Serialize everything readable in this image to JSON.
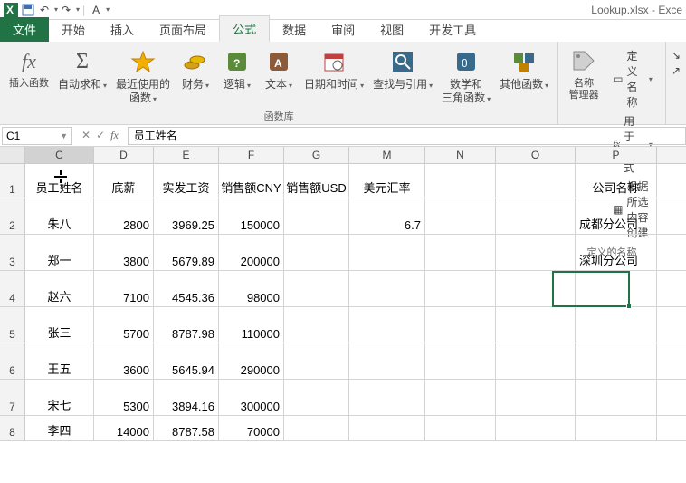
{
  "app": {
    "title": "Lookup.xlsx - Exce"
  },
  "qat": {
    "undo": "↶",
    "redo": "↷",
    "letter": "A"
  },
  "tabs": {
    "file": "文件",
    "home": "开始",
    "insert": "插入",
    "layout": "页面布局",
    "formula": "公式",
    "data": "数据",
    "review": "审阅",
    "view": "视图",
    "dev": "开发工具"
  },
  "ribbon": {
    "insert_fn": "插入函数",
    "autosum": "自动求和",
    "recent": "最近使用的\n函数",
    "finance": "财务",
    "logic": "逻辑",
    "text": "文本",
    "datetime": "日期和时间",
    "lookup": "查找与引用",
    "math": "数学和\n三角函数",
    "other": "其他函数",
    "group_lib": "函数库",
    "name_mgr": "名称\n管理器",
    "def_name": "定义名称",
    "use_in": "用于公式",
    "from_sel": "根据所选内容创建",
    "group_names": "定义的名称"
  },
  "namebox": "C1",
  "formula_value": "员工姓名",
  "columns": [
    "C",
    "D",
    "E",
    "F",
    "G",
    "M",
    "N",
    "O",
    "P"
  ],
  "header_row": {
    "c": "员工姓名",
    "d": "底薪",
    "e": "实发工资",
    "f": "销售额CNY",
    "g": "销售额USD",
    "m": "美元汇率",
    "p": "公司名称"
  },
  "data_rows": [
    {
      "rn": "2",
      "c": "朱八",
      "d": "2800",
      "e": "3969.25",
      "f": "150000",
      "m": "6.7",
      "p": "成都分公司"
    },
    {
      "rn": "3",
      "c": "郑一",
      "d": "3800",
      "e": "5679.89",
      "f": "200000",
      "m": "",
      "p": "深圳分公司"
    },
    {
      "rn": "4",
      "c": "赵六",
      "d": "7100",
      "e": "4545.36",
      "f": "98000",
      "m": "",
      "p": ""
    },
    {
      "rn": "5",
      "c": "张三",
      "d": "5700",
      "e": "8787.98",
      "f": "110000",
      "m": "",
      "p": ""
    },
    {
      "rn": "6",
      "c": "王五",
      "d": "3600",
      "e": "5645.94",
      "f": "290000",
      "m": "",
      "p": ""
    },
    {
      "rn": "7",
      "c": "宋七",
      "d": "5300",
      "e": "3894.16",
      "f": "300000",
      "m": "",
      "p": ""
    },
    {
      "rn": "8",
      "c": "李四",
      "d": "14000",
      "e": "8787.58",
      "f": "70000",
      "m": "",
      "p": ""
    }
  ]
}
